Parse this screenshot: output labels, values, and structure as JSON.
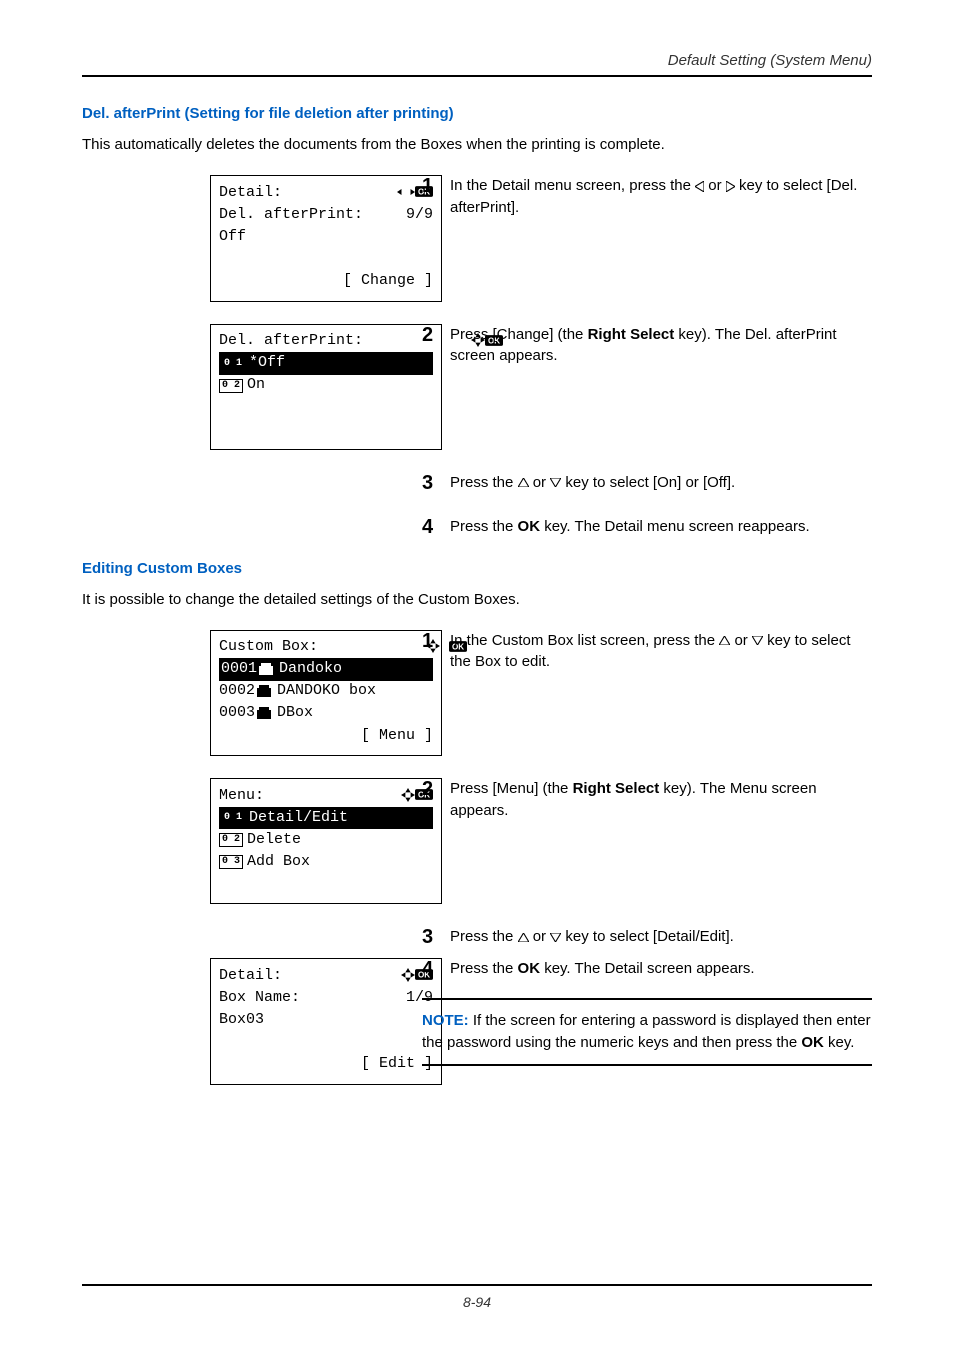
{
  "header": {
    "text": "Default Setting (System Menu)"
  },
  "section1": {
    "heading": "Del. afterPrint (Setting for file deletion after printing)",
    "intro": "This automatically deletes the documents from the Boxes when the printing is complete.",
    "lcd1": {
      "title": "Detail:",
      "line2_left": "Del. afterPrint:",
      "line2_right": "9/9",
      "line3": "Off",
      "soft": "[ Change  ]"
    },
    "step1": {
      "num": "1",
      "pre": "In the Detail menu screen, press the ",
      "post": " key to select [Del. afterPrint]."
    },
    "lcd2": {
      "title": "Del. afterPrint:",
      "opt1_num": "0 1",
      "opt1": "*Off",
      "opt2_num": "0 2",
      "opt2": "On"
    },
    "step2": {
      "num": "2",
      "pre": "Press [Change] (the ",
      "bold": "Right Select",
      "post": " key). The Del. afterPrint screen appears."
    },
    "step3": {
      "num": "3",
      "pre": "Press the ",
      "mid": " or ",
      "post": " key to select [On] or [Off]."
    },
    "step4": {
      "num": "4",
      "pre": "Press the ",
      "bold": "OK",
      "post": " key. The Detail menu screen reappears."
    }
  },
  "section2": {
    "heading": "Editing Custom Boxes",
    "intro": "It is possible to change the detailed settings of the Custom Boxes.",
    "lcd1": {
      "title": "Custom Box:",
      "r1_id": "0001",
      "r1_name": "Dandoko",
      "r2_id": "0002",
      "r2_name": "DANDOKO box",
      "r3_id": "0003",
      "r3_name": "DBox",
      "soft": "[  Menu   ]"
    },
    "step1": {
      "num": "1",
      "pre": "In the Custom Box list screen, press the ",
      "mid": " or ",
      "post": " key to select the Box to edit."
    },
    "lcd2": {
      "title": "Menu:",
      "opt1_num": "0 1",
      "opt1": "Detail/Edit",
      "opt2_num": "0 2",
      "opt2": "Delete",
      "opt3_num": "0 3",
      "opt3": "Add Box"
    },
    "step2": {
      "num": "2",
      "pre": "Press [Menu] (the ",
      "bold": "Right Select",
      "post": " key). The Menu screen appears."
    },
    "step3": {
      "num": "3",
      "pre": "Press the ",
      "mid": " or ",
      "post": " key to select [Detail/Edit]."
    },
    "step4": {
      "num": "4",
      "pre": "Press the ",
      "bold": "OK",
      "post": " key. The Detail screen appears."
    },
    "lcd3": {
      "title": "Detail:",
      "line2_left": "Box Name:",
      "line2_right": "1/9",
      "line3": "Box03",
      "soft": "[  Edit   ]"
    },
    "note": {
      "label": "NOTE:",
      "t1": " If the screen for entering a password is displayed then enter the password using the numeric keys and then press the ",
      "bold": "OK",
      "t2": " key."
    }
  },
  "footer": {
    "text": "8-94"
  }
}
